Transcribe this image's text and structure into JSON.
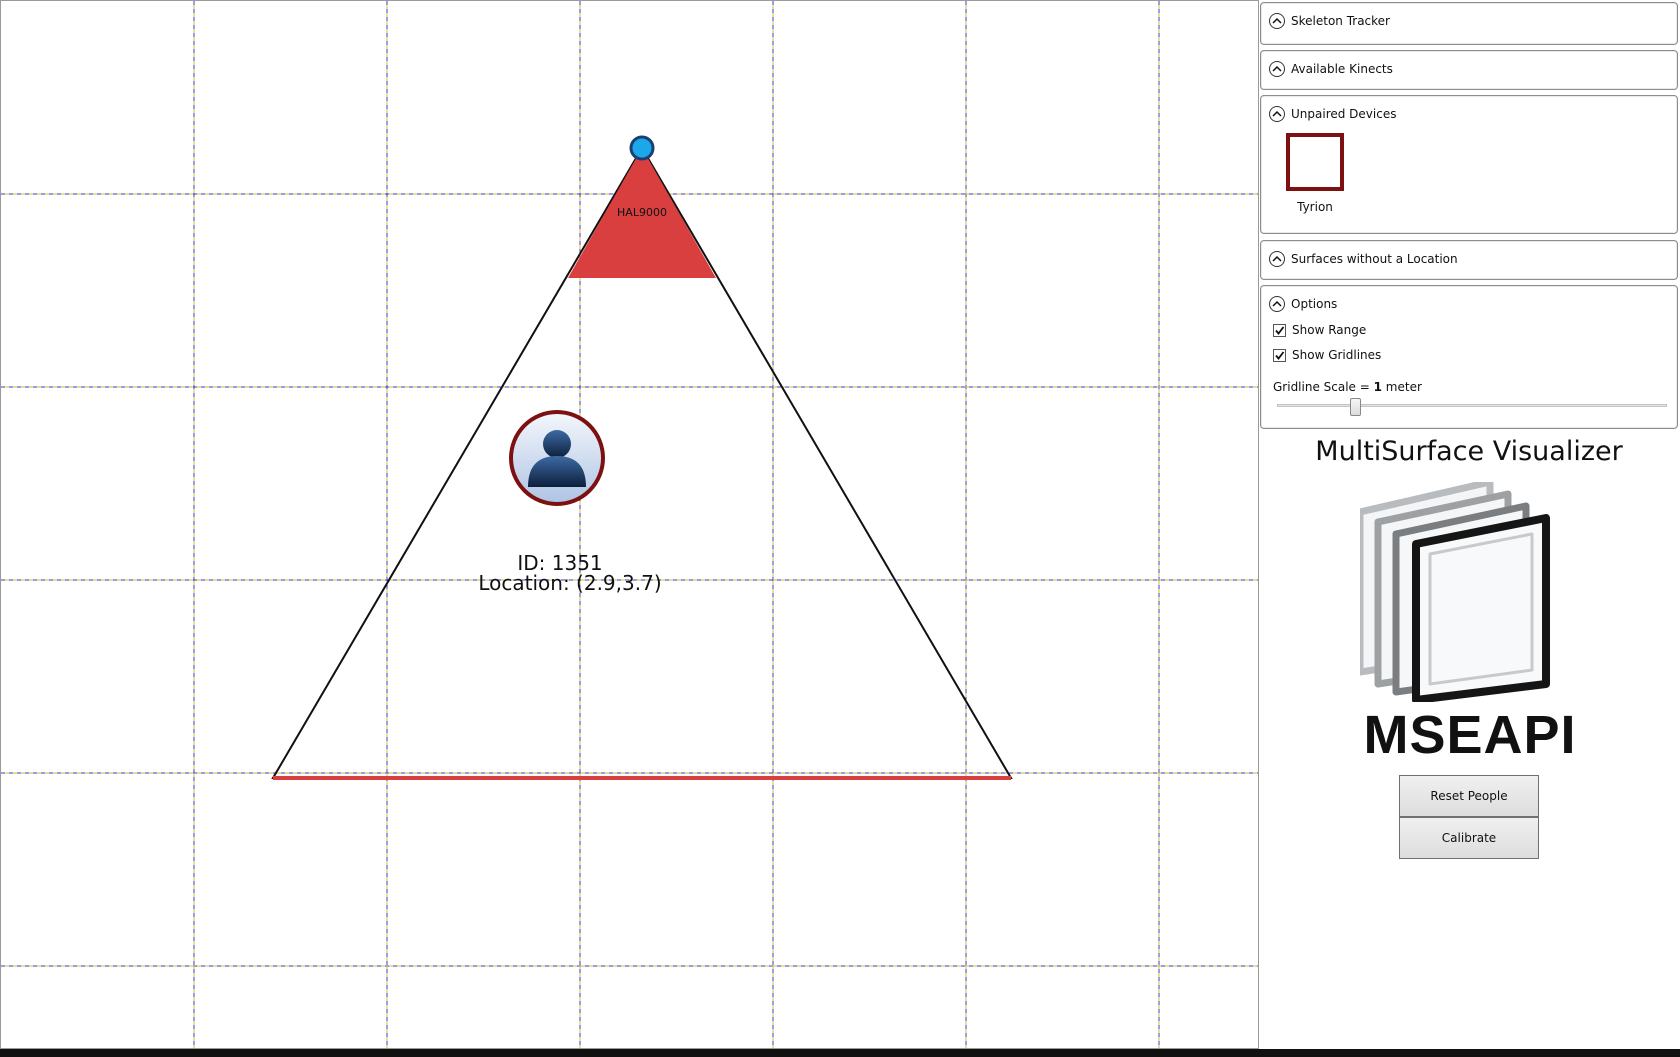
{
  "canvas": {
    "kinect_name": "HAL9000",
    "person": {
      "id_text": "ID: 1351",
      "location_text": "Location: (2.9,3.7)"
    }
  },
  "panels": {
    "skeleton_tracker": {
      "title": "Skeleton Tracker"
    },
    "available_kinects": {
      "title": "Available Kinects"
    },
    "unpaired_devices": {
      "title": "Unpaired Devices",
      "devices": [
        {
          "name": "Tyrion"
        }
      ]
    },
    "surfaces_without_location": {
      "title": "Surfaces without a Location"
    },
    "options": {
      "title": "Options",
      "show_range_label": "Show Range",
      "show_range_checked": true,
      "show_gridlines_label": "Show Gridlines",
      "show_gridlines_checked": true,
      "gridline_scale_prefix": "Gridline Scale = ",
      "gridline_scale_value": "1",
      "gridline_scale_unit": " meter"
    }
  },
  "branding": {
    "app_title": "MultiSurface Visualizer",
    "logo_text": "MSEAPI"
  },
  "buttons": {
    "reset_people": "Reset People",
    "calibrate": "Calibrate"
  },
  "colors": {
    "kinect_range": "#d93f3f",
    "device_border": "#7d1111",
    "kinect_dot": "#1aa8ea",
    "grid_blue": "#3a3ae6",
    "grid_yellow": "#d8c21c"
  }
}
